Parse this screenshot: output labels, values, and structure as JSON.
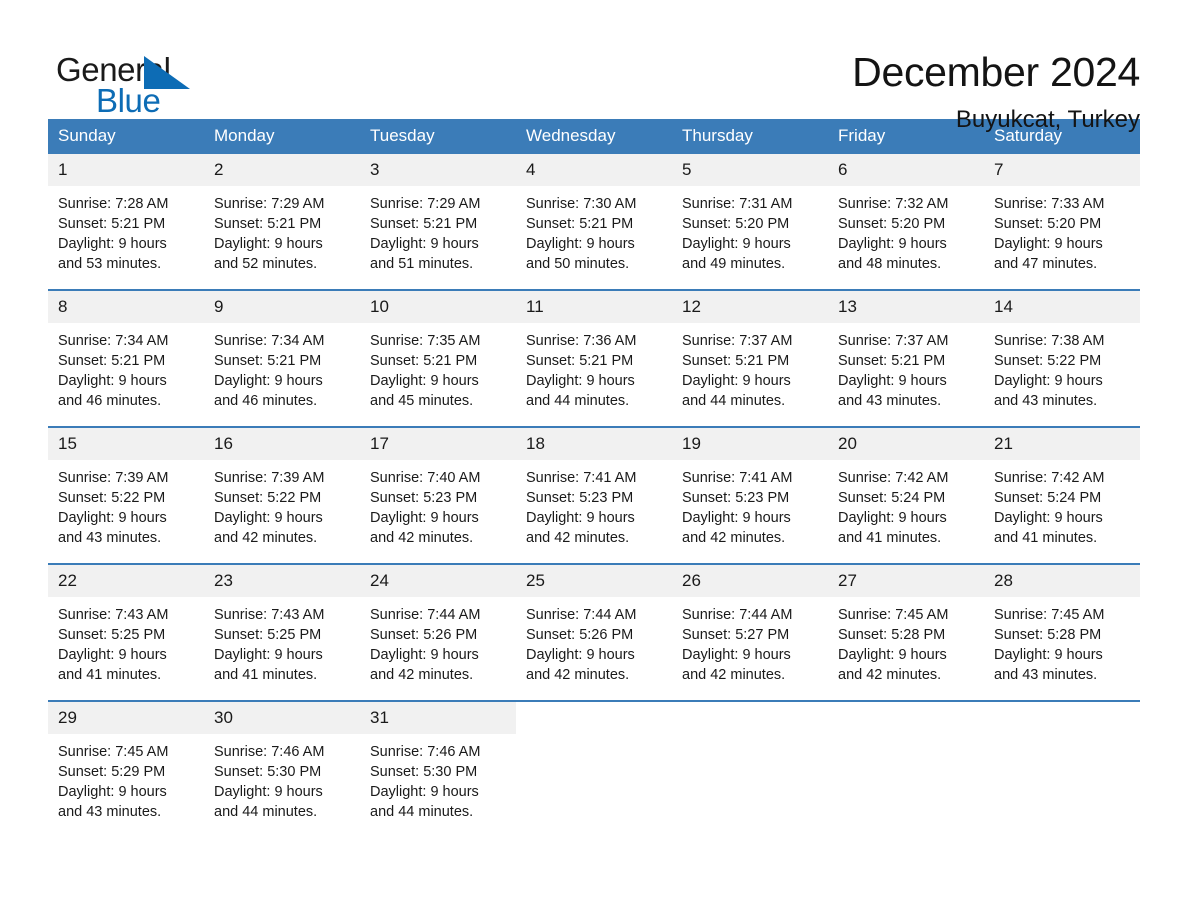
{
  "brand": {
    "name_dark": "General",
    "name_light": "Blue",
    "triangle_color": "#0d6cb5",
    "logo_icon": "triangle-logo-icon"
  },
  "header": {
    "title": "December 2024",
    "subtitle": "Buyukcat, Turkey"
  },
  "colors": {
    "header_blue": "#3b7cb8",
    "row_separator": "#3b7cb8",
    "daynum_band": "#f1f1f1",
    "text": "#1a1a1a",
    "brand_blue": "#0d6cb5"
  },
  "weekday_headers": [
    "Sunday",
    "Monday",
    "Tuesday",
    "Wednesday",
    "Thursday",
    "Friday",
    "Saturday"
  ],
  "weeks": [
    [
      {
        "day": "1",
        "sunrise": "Sunrise: 7:28 AM",
        "sunset": "Sunset: 5:21 PM",
        "daylight1": "Daylight: 9 hours",
        "daylight2": "and 53 minutes."
      },
      {
        "day": "2",
        "sunrise": "Sunrise: 7:29 AM",
        "sunset": "Sunset: 5:21 PM",
        "daylight1": "Daylight: 9 hours",
        "daylight2": "and 52 minutes."
      },
      {
        "day": "3",
        "sunrise": "Sunrise: 7:29 AM",
        "sunset": "Sunset: 5:21 PM",
        "daylight1": "Daylight: 9 hours",
        "daylight2": "and 51 minutes."
      },
      {
        "day": "4",
        "sunrise": "Sunrise: 7:30 AM",
        "sunset": "Sunset: 5:21 PM",
        "daylight1": "Daylight: 9 hours",
        "daylight2": "and 50 minutes."
      },
      {
        "day": "5",
        "sunrise": "Sunrise: 7:31 AM",
        "sunset": "Sunset: 5:20 PM",
        "daylight1": "Daylight: 9 hours",
        "daylight2": "and 49 minutes."
      },
      {
        "day": "6",
        "sunrise": "Sunrise: 7:32 AM",
        "sunset": "Sunset: 5:20 PM",
        "daylight1": "Daylight: 9 hours",
        "daylight2": "and 48 minutes."
      },
      {
        "day": "7",
        "sunrise": "Sunrise: 7:33 AM",
        "sunset": "Sunset: 5:20 PM",
        "daylight1": "Daylight: 9 hours",
        "daylight2": "and 47 minutes."
      }
    ],
    [
      {
        "day": "8",
        "sunrise": "Sunrise: 7:34 AM",
        "sunset": "Sunset: 5:21 PM",
        "daylight1": "Daylight: 9 hours",
        "daylight2": "and 46 minutes."
      },
      {
        "day": "9",
        "sunrise": "Sunrise: 7:34 AM",
        "sunset": "Sunset: 5:21 PM",
        "daylight1": "Daylight: 9 hours",
        "daylight2": "and 46 minutes."
      },
      {
        "day": "10",
        "sunrise": "Sunrise: 7:35 AM",
        "sunset": "Sunset: 5:21 PM",
        "daylight1": "Daylight: 9 hours",
        "daylight2": "and 45 minutes."
      },
      {
        "day": "11",
        "sunrise": "Sunrise: 7:36 AM",
        "sunset": "Sunset: 5:21 PM",
        "daylight1": "Daylight: 9 hours",
        "daylight2": "and 44 minutes."
      },
      {
        "day": "12",
        "sunrise": "Sunrise: 7:37 AM",
        "sunset": "Sunset: 5:21 PM",
        "daylight1": "Daylight: 9 hours",
        "daylight2": "and 44 minutes."
      },
      {
        "day": "13",
        "sunrise": "Sunrise: 7:37 AM",
        "sunset": "Sunset: 5:21 PM",
        "daylight1": "Daylight: 9 hours",
        "daylight2": "and 43 minutes."
      },
      {
        "day": "14",
        "sunrise": "Sunrise: 7:38 AM",
        "sunset": "Sunset: 5:22 PM",
        "daylight1": "Daylight: 9 hours",
        "daylight2": "and 43 minutes."
      }
    ],
    [
      {
        "day": "15",
        "sunrise": "Sunrise: 7:39 AM",
        "sunset": "Sunset: 5:22 PM",
        "daylight1": "Daylight: 9 hours",
        "daylight2": "and 43 minutes."
      },
      {
        "day": "16",
        "sunrise": "Sunrise: 7:39 AM",
        "sunset": "Sunset: 5:22 PM",
        "daylight1": "Daylight: 9 hours",
        "daylight2": "and 42 minutes."
      },
      {
        "day": "17",
        "sunrise": "Sunrise: 7:40 AM",
        "sunset": "Sunset: 5:23 PM",
        "daylight1": "Daylight: 9 hours",
        "daylight2": "and 42 minutes."
      },
      {
        "day": "18",
        "sunrise": "Sunrise: 7:41 AM",
        "sunset": "Sunset: 5:23 PM",
        "daylight1": "Daylight: 9 hours",
        "daylight2": "and 42 minutes."
      },
      {
        "day": "19",
        "sunrise": "Sunrise: 7:41 AM",
        "sunset": "Sunset: 5:23 PM",
        "daylight1": "Daylight: 9 hours",
        "daylight2": "and 42 minutes."
      },
      {
        "day": "20",
        "sunrise": "Sunrise: 7:42 AM",
        "sunset": "Sunset: 5:24 PM",
        "daylight1": "Daylight: 9 hours",
        "daylight2": "and 41 minutes."
      },
      {
        "day": "21",
        "sunrise": "Sunrise: 7:42 AM",
        "sunset": "Sunset: 5:24 PM",
        "daylight1": "Daylight: 9 hours",
        "daylight2": "and 41 minutes."
      }
    ],
    [
      {
        "day": "22",
        "sunrise": "Sunrise: 7:43 AM",
        "sunset": "Sunset: 5:25 PM",
        "daylight1": "Daylight: 9 hours",
        "daylight2": "and 41 minutes."
      },
      {
        "day": "23",
        "sunrise": "Sunrise: 7:43 AM",
        "sunset": "Sunset: 5:25 PM",
        "daylight1": "Daylight: 9 hours",
        "daylight2": "and 41 minutes."
      },
      {
        "day": "24",
        "sunrise": "Sunrise: 7:44 AM",
        "sunset": "Sunset: 5:26 PM",
        "daylight1": "Daylight: 9 hours",
        "daylight2": "and 42 minutes."
      },
      {
        "day": "25",
        "sunrise": "Sunrise: 7:44 AM",
        "sunset": "Sunset: 5:26 PM",
        "daylight1": "Daylight: 9 hours",
        "daylight2": "and 42 minutes."
      },
      {
        "day": "26",
        "sunrise": "Sunrise: 7:44 AM",
        "sunset": "Sunset: 5:27 PM",
        "daylight1": "Daylight: 9 hours",
        "daylight2": "and 42 minutes."
      },
      {
        "day": "27",
        "sunrise": "Sunrise: 7:45 AM",
        "sunset": "Sunset: 5:28 PM",
        "daylight1": "Daylight: 9 hours",
        "daylight2": "and 42 minutes."
      },
      {
        "day": "28",
        "sunrise": "Sunrise: 7:45 AM",
        "sunset": "Sunset: 5:28 PM",
        "daylight1": "Daylight: 9 hours",
        "daylight2": "and 43 minutes."
      }
    ],
    [
      {
        "day": "29",
        "sunrise": "Sunrise: 7:45 AM",
        "sunset": "Sunset: 5:29 PM",
        "daylight1": "Daylight: 9 hours",
        "daylight2": "and 43 minutes."
      },
      {
        "day": "30",
        "sunrise": "Sunrise: 7:46 AM",
        "sunset": "Sunset: 5:30 PM",
        "daylight1": "Daylight: 9 hours",
        "daylight2": "and 44 minutes."
      },
      {
        "day": "31",
        "sunrise": "Sunrise: 7:46 AM",
        "sunset": "Sunset: 5:30 PM",
        "daylight1": "Daylight: 9 hours",
        "daylight2": "and 44 minutes."
      },
      {
        "day": "",
        "sunrise": "",
        "sunset": "",
        "daylight1": "",
        "daylight2": ""
      },
      {
        "day": "",
        "sunrise": "",
        "sunset": "",
        "daylight1": "",
        "daylight2": ""
      },
      {
        "day": "",
        "sunrise": "",
        "sunset": "",
        "daylight1": "",
        "daylight2": ""
      },
      {
        "day": "",
        "sunrise": "",
        "sunset": "",
        "daylight1": "",
        "daylight2": ""
      }
    ]
  ]
}
